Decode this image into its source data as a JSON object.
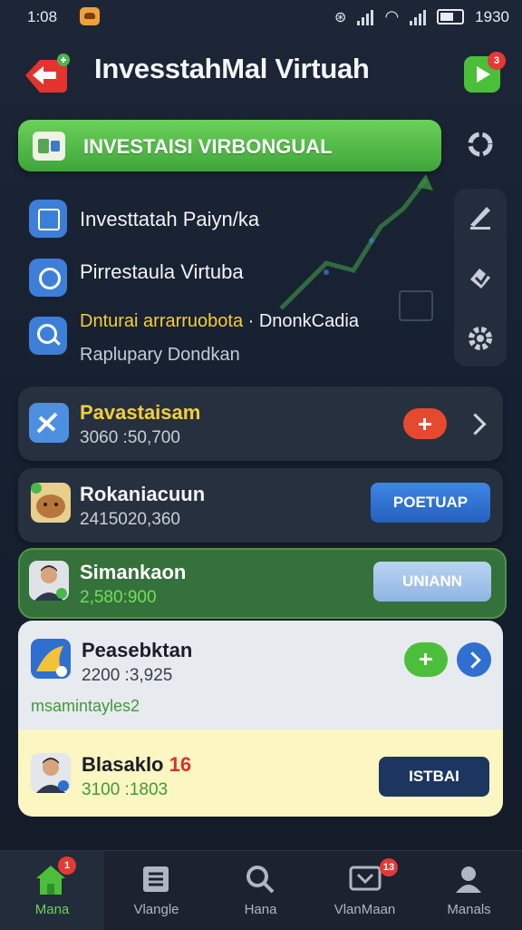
{
  "status_bar": {
    "time": "1:08",
    "battery": "1930"
  },
  "header": {
    "title": "InvesstahMal Virtuah",
    "play_badge": "3"
  },
  "banner": {
    "label": "INVESTAISI VIRBONGUAL"
  },
  "features": [
    {
      "label": "Investtatah Paiyn/ka",
      "icon": "document-icon"
    },
    {
      "label": "Pirrestaula Virtuba",
      "icon": "lens-icon"
    },
    {
      "label": "Dnturai arrarruobota · DnonkCadia",
      "highlight": "Dnturai arrarruobota",
      "rest": " · DnonkCadia",
      "sub": "Raplupary Dondkan",
      "icon": "search-icon"
    }
  ],
  "cards": [
    {
      "title": "Pavastaisam",
      "value": "3060 :50,700",
      "style": "dark"
    },
    {
      "title": "Rokaniacuun",
      "value": "2415020,360",
      "button": "POETUAP",
      "style": "dark"
    },
    {
      "title": "Simankaon",
      "value": "2,580:900",
      "button": "UNIANN",
      "style": "green"
    },
    {
      "title": "Peasebktan",
      "value": "2200 :3,925",
      "tag": "msamintayles2",
      "style": "light"
    },
    {
      "title": "Blasaklo",
      "title_num": "16",
      "value": "3100 :1803",
      "button": "ISTBAI",
      "style": "yellow"
    }
  ],
  "bottom_nav": [
    {
      "label": "Mana",
      "icon": "home-icon",
      "badge": "1",
      "active": true
    },
    {
      "label": "Vlangle",
      "icon": "list-icon",
      "badge": "",
      "active": false
    },
    {
      "label": "Hana",
      "icon": "search-icon",
      "badge": "",
      "active": false
    },
    {
      "label": "VlanMaan",
      "icon": "message-icon",
      "badge": "13",
      "active": false
    },
    {
      "label": "Manals",
      "icon": "profile-icon",
      "badge": "",
      "active": false
    }
  ],
  "colors": {
    "accent_green": "#4cbf3a",
    "accent_blue": "#2f6fd0",
    "highlight_yellow": "#f2cf3a",
    "danger": "#e53935"
  }
}
